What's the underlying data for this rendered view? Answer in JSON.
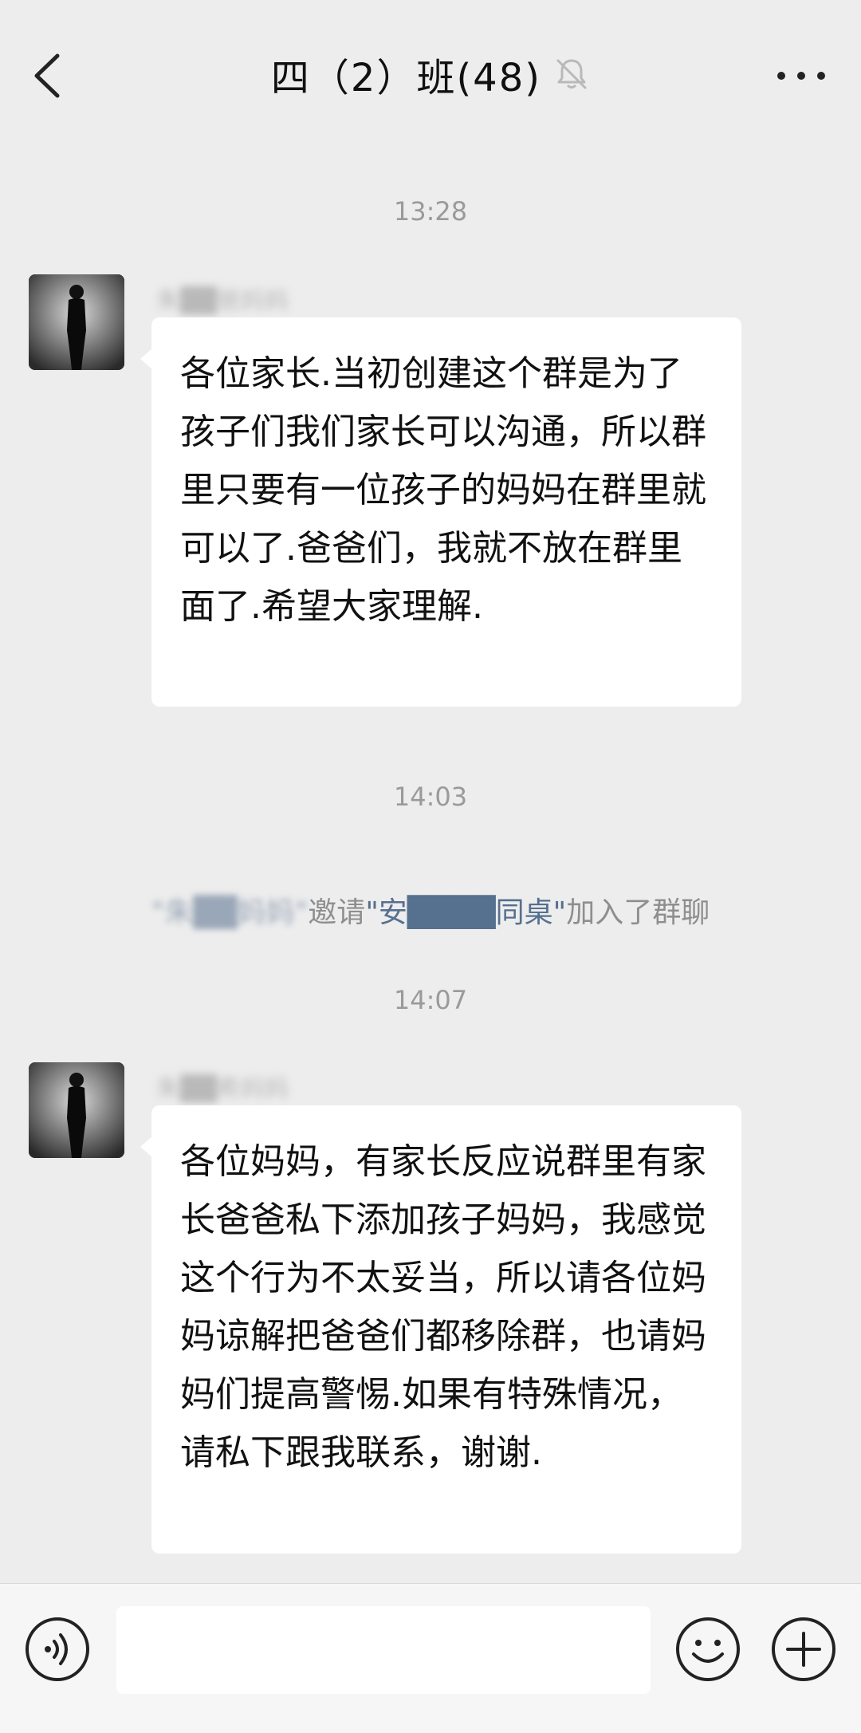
{
  "header": {
    "title": "四（2）班(48)",
    "icons": {
      "back": "chevron-left-icon",
      "mute": "bell-muted-icon",
      "more": "more-dots-icon"
    }
  },
  "messages": [
    {
      "time": "13:28",
      "sender": "朱██爸妈妈",
      "text": "各位家长.当初创建这个群是为了孩子们我们家长可以沟通，所以群里只要有一位孩子的妈妈在群里就可以了.爸爸们，我就不放在群里面了.希望大家理解."
    },
    {
      "time": "14:03",
      "system": {
        "inviter": "\"朱██妈妈\"",
        "invite_text": "邀请",
        "invitee": "\"安████同桌\"",
        "joined_text": "加入了群聊"
      }
    },
    {
      "time": "14:07",
      "sender": "朱██希妈妈",
      "text": "各位妈妈，有家长反应说群里有家长爸爸私下添加孩子妈妈，我感觉这个行为不太妥当，所以请各位妈妈谅解把爸爸们都移除群，也请妈妈们提高警惕.如果有特殊情况，请私下跟我联系，谢谢."
    }
  ],
  "input_bar": {
    "icons": {
      "voice": "voice-icon",
      "emoji": "emoji-icon",
      "plus": "plus-circle-icon"
    }
  }
}
